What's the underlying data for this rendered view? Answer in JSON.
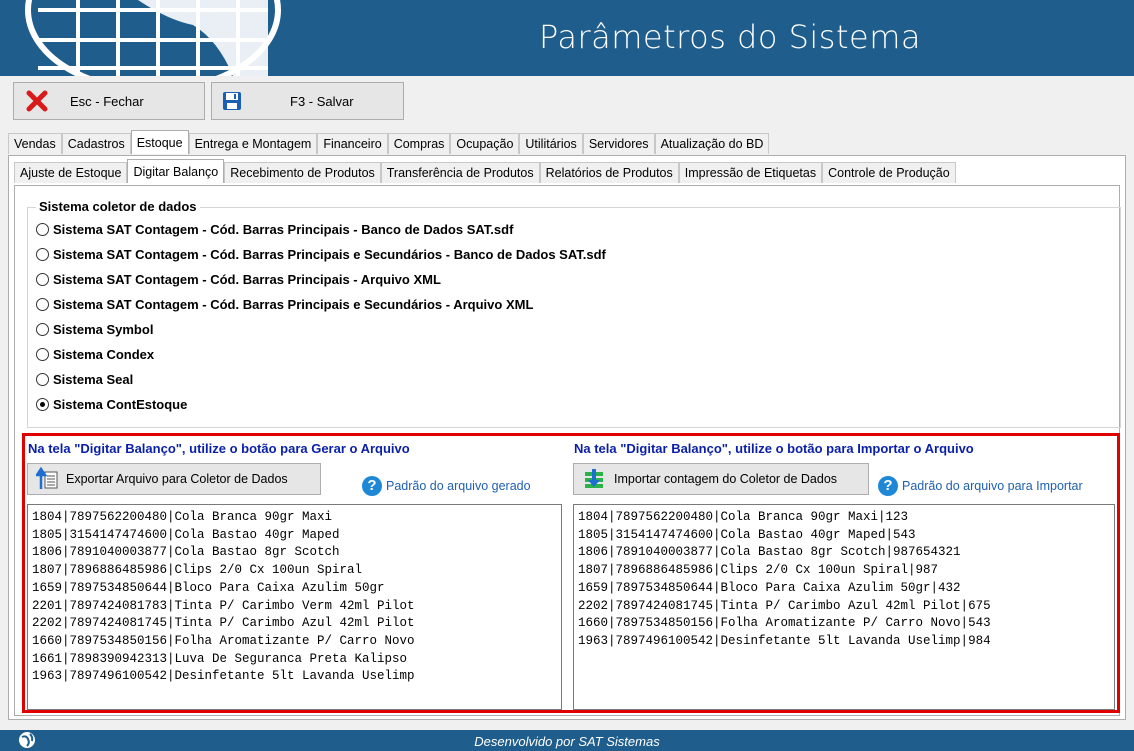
{
  "window": {
    "title": "Parâmetros do Sistema"
  },
  "toolbar": {
    "close_label": "Esc - Fechar",
    "save_label": "F3 - Salvar"
  },
  "main_tabs": [
    "Vendas",
    "Cadastros",
    "Estoque",
    "Entrega e Montagem",
    "Financeiro",
    "Compras",
    "Ocupação",
    "Utilitários",
    "Servidores",
    "Atualização do BD"
  ],
  "main_tab_active": "Estoque",
  "sub_tabs": [
    "Ajuste de Estoque",
    "Digitar Balanço",
    "Recebimento de Produtos",
    "Transferência de Produtos",
    "Relatórios de Produtos",
    "Impressão de Etiquetas",
    "Controle de Produção"
  ],
  "sub_tab_active": "Digitar Balanço",
  "collector": {
    "group_title": "Sistema coletor de dados",
    "options": [
      {
        "label": "Sistema SAT Contagem - Cód. Barras Principais - Banco de Dados SAT.sdf",
        "selected": false
      },
      {
        "label": "Sistema SAT Contagem - Cód. Barras Principais e Secundários - Banco de Dados SAT.sdf",
        "selected": false
      },
      {
        "label": "Sistema SAT Contagem - Cód. Barras Principais - Arquivo XML",
        "selected": false
      },
      {
        "label": "Sistema SAT Contagem - Cód. Barras Principais e Secundários - Arquivo XML",
        "selected": false
      },
      {
        "label": "Sistema Symbol",
        "selected": false
      },
      {
        "label": "Sistema Condex",
        "selected": false
      },
      {
        "label": "Sistema Seal",
        "selected": false
      },
      {
        "label": "Sistema ContEstoque",
        "selected": true
      }
    ]
  },
  "export": {
    "heading": "Na tela \"Digitar Balanço\", utilize o botão para Gerar o Arquivo",
    "button_label": "Exportar Arquivo para Coletor de Dados",
    "help_label": "Padrão do arquivo gerado",
    "lines": [
      "1804|7897562200480|Cola Branca 90gr Maxi",
      "1805|3154147474600|Cola Bastao 40gr Maped",
      "1806|7891040003877|Cola Bastao 8gr Scotch",
      "1807|7896886485986|Clips 2/0 Cx 100un Spiral",
      "1659|7897534850644|Bloco Para Caixa Azulim 50gr",
      "2201|7897424081783|Tinta P/ Carimbo Verm 42ml Pilot",
      "2202|7897424081745|Tinta P/ Carimbo Azul 42ml Pilot",
      "1660|7897534850156|Folha Aromatizante P/ Carro Novo",
      "1661|7898390942313|Luva De Seguranca Preta Kalipso",
      "1963|7897496100542|Desinfetante 5lt Lavanda Uselimp"
    ]
  },
  "import": {
    "heading": "Na tela \"Digitar Balanço\", utilize o botão para Importar o Arquivo",
    "button_label": "Importar contagem do Coletor de Dados",
    "help_label": "Padrão do arquivo para Importar",
    "lines": [
      "1804|7897562200480|Cola Branca 90gr Maxi|123",
      "1805|3154147474600|Cola Bastao 40gr Maped|543",
      "1806|7891040003877|Cola Bastao 8gr Scotch|987654321",
      "1807|7896886485986|Clips 2/0 Cx 100un Spiral|987",
      "1659|7897534850644|Bloco Para Caixa Azulim 50gr|432",
      "2202|7897424081745|Tinta P/ Carimbo Azul 42ml Pilot|675",
      "1660|7897534850156|Folha Aromatizante P/ Carro Novo|543",
      "1963|7897496100542|Desinfetante 5lt Lavanda Uselimp|984"
    ]
  },
  "footer": {
    "text": "Desenvolvido por SAT Sistemas"
  },
  "colors": {
    "header_bg": "#1f5d8c",
    "highlight_border": "#e00000",
    "heading_blue": "#0a1fa8"
  }
}
